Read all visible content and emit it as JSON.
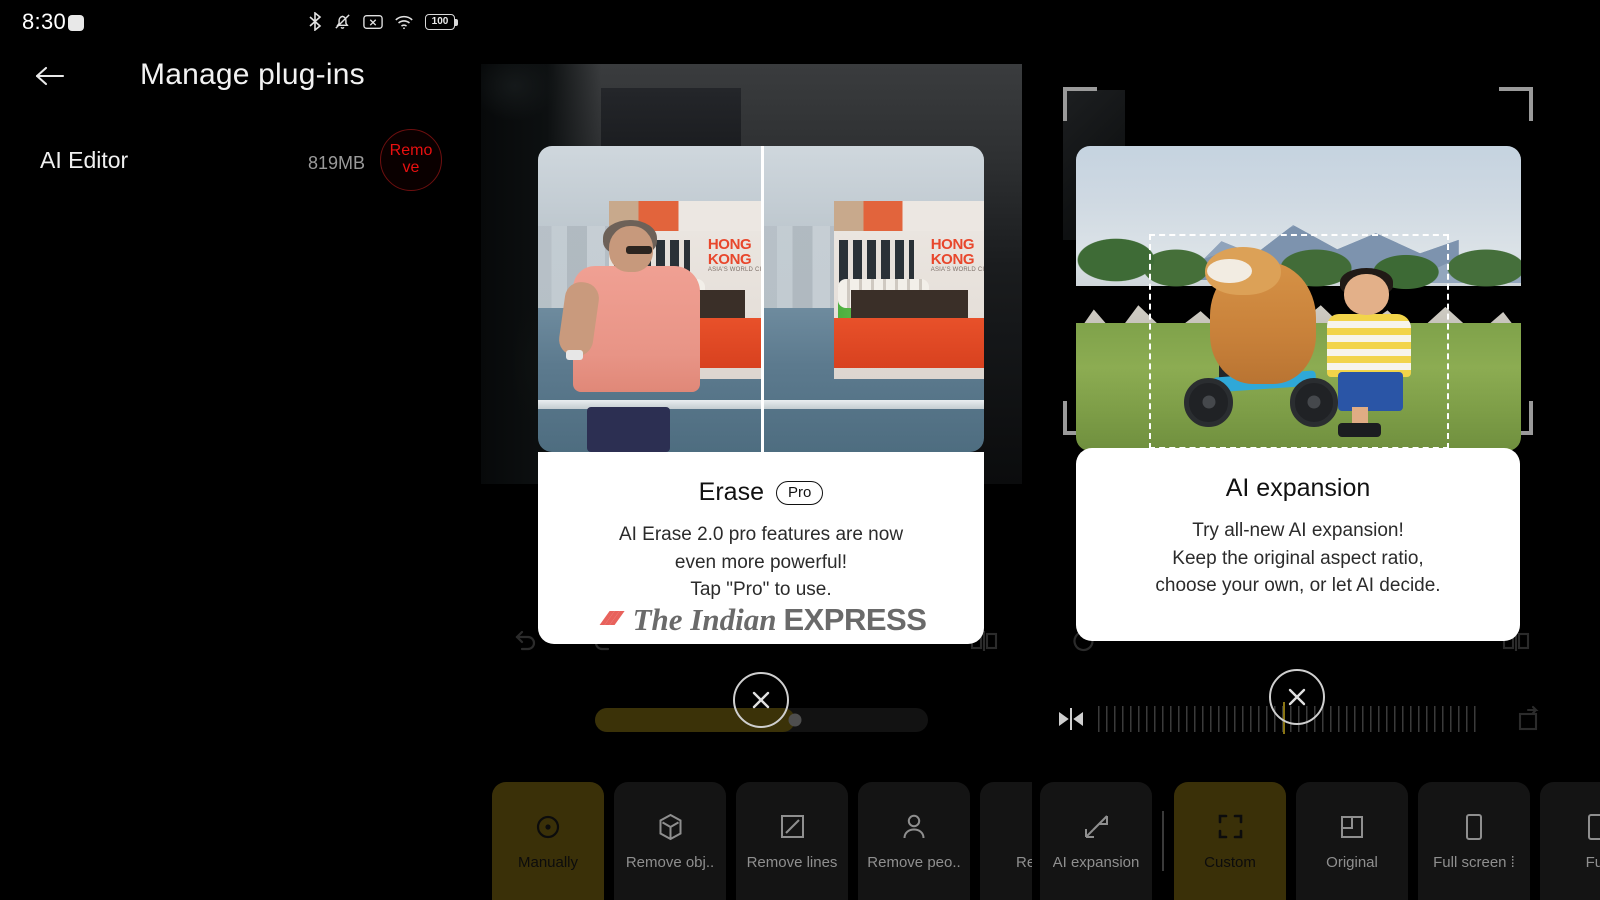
{
  "status_bar": {
    "time": "8:30",
    "icons": [
      "recording-dot-icon",
      "bluetooth-icon",
      "mute-bell-icon",
      "sim-off-icon",
      "wifi-icon",
      "battery-icon"
    ],
    "battery_level": "100"
  },
  "header": {
    "back_icon": "back-arrow-icon",
    "title": "Manage plug-ins"
  },
  "plugin": {
    "name": "AI Editor",
    "size": "819MB",
    "remove_label": "Remove",
    "remove_color": "#e81010"
  },
  "erase_panel": {
    "card": {
      "title": "Erase",
      "badge": "Pro",
      "description": "AI Erase 2.0 pro features are now\neven more powerful!\nTap \"Pro\" to use."
    },
    "watermark": {
      "the": "The Indian",
      "express": "EXPRESS"
    },
    "photo": {
      "overlay_text_line1": "HONG",
      "overlay_text_line2": "KONG",
      "overlay_sub": "ASIA'S WORLD CITY"
    },
    "controls": {
      "undo_icon": "undo-icon",
      "redo_icon": "redo-icon",
      "compare_icon": "compare-icon",
      "close_icon": "close-icon",
      "slider_fill_percent": 60
    },
    "toolbar": [
      {
        "label": "Manually",
        "icon": "brush-dot-icon",
        "selected": true
      },
      {
        "label": "Remove obj..",
        "icon": "cube-icon",
        "selected": false
      },
      {
        "label": "Remove lines",
        "icon": "line-square-icon",
        "selected": false
      },
      {
        "label": "Remove peo..",
        "icon": "person-icon",
        "selected": false
      },
      {
        "label": "Remo",
        "icon": "partial-icon",
        "selected": false
      }
    ]
  },
  "expand_panel": {
    "card": {
      "title": "AI expansion",
      "description": "Try all-new AI expansion!\nKeep the original aspect ratio,\nchoose your own, or let AI decide."
    },
    "controls": {
      "rotate_icon": "rotate-icon",
      "compare_icon": "compare-icon",
      "flip_icon": "flip-horizontal-icon",
      "reset_icon": "reset-icon",
      "close_icon": "close-icon",
      "ruler_center_color": "#8a7513"
    },
    "toolbar": [
      {
        "label": "AI expansion",
        "icon": "expand-arrow-icon",
        "selected": false
      },
      {
        "label": "Custom",
        "icon": "crop-corners-icon",
        "selected": true
      },
      {
        "label": "Original",
        "icon": "original-ratio-icon",
        "selected": false
      },
      {
        "label": "Full screen ⁞",
        "icon": "phone-screen-icon",
        "selected": false
      },
      {
        "label": "Ful",
        "icon": "partial-icon",
        "selected": false
      }
    ]
  },
  "theme": {
    "background": "#000000",
    "selected_tool_bg": "#3a3008",
    "card_bg": "#ffffff",
    "accent_yellow": "#8a7513"
  }
}
